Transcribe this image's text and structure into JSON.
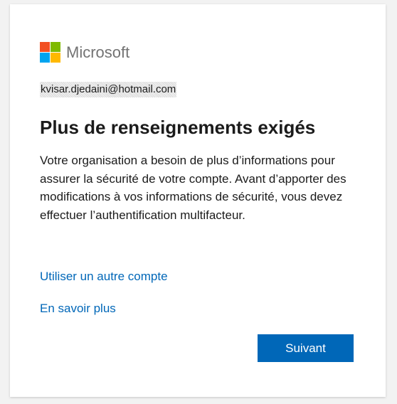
{
  "brand": {
    "name": "Microsoft",
    "logo_colors": [
      "#f25022",
      "#7fba00",
      "#00a4ef",
      "#ffb900"
    ],
    "wordmark_color": "#737373"
  },
  "account": {
    "email": "kvisar.djedaini@hotmail.com"
  },
  "page": {
    "title": "Plus de renseignements exigés",
    "description": "Votre organisation a besoin de plus d’informations pour assurer la sécurité de votre compte. Avant d’apporter des modifications à vos informations de sécurité, vous devez effectuer l’authentification multifacteur."
  },
  "links": {
    "use_other_account": "Utiliser un autre compte",
    "learn_more": "En savoir plus",
    "color": "#0067b8"
  },
  "actions": {
    "next_label": "Suivant",
    "accent": "#0067b8"
  }
}
